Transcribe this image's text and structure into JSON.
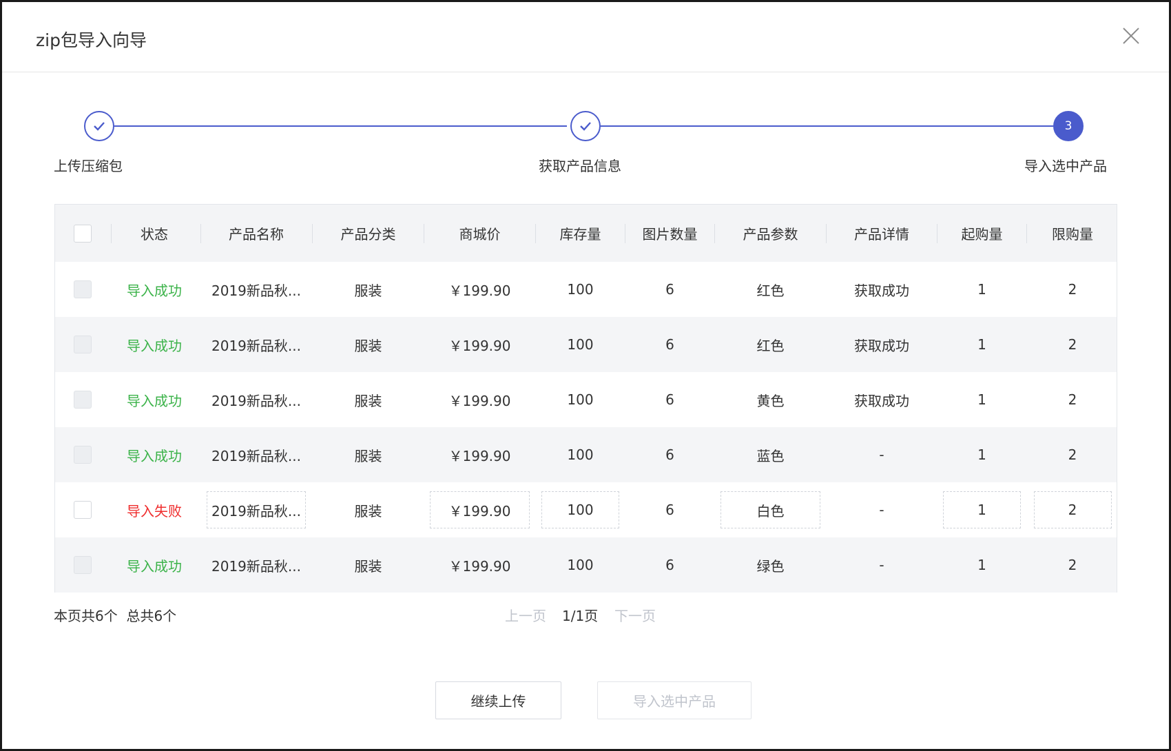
{
  "dialog": {
    "title": "zip包导入向导"
  },
  "steps": [
    {
      "label": "上传压缩包",
      "state": "done"
    },
    {
      "label": "获取产品信息",
      "state": "done"
    },
    {
      "label": "导入选中产品",
      "state": "active",
      "number": "3"
    }
  ],
  "colors": {
    "accent": "#4a5bcc",
    "success": "#3cb34a",
    "error": "#ef2d2d",
    "disabled_text": "#c0c4cc"
  },
  "table": {
    "headers": [
      "状态",
      "产品名称",
      "产品分类",
      "商城价",
      "库存量",
      "图片数量",
      "产品参数",
      "产品详情",
      "起购量",
      "限购量"
    ],
    "rows": [
      {
        "status": "导入成功",
        "status_type": "success",
        "name": "2019新品秋...",
        "category": "服装",
        "price": "￥199.90",
        "stock": "100",
        "images": "6",
        "params": "红色",
        "detail": "获取成功",
        "min_buy": "1",
        "max_buy": "2"
      },
      {
        "status": "导入成功",
        "status_type": "success",
        "name": "2019新品秋...",
        "category": "服装",
        "price": "￥199.90",
        "stock": "100",
        "images": "6",
        "params": "红色",
        "detail": "获取成功",
        "min_buy": "1",
        "max_buy": "2"
      },
      {
        "status": "导入成功",
        "status_type": "success",
        "name": "2019新品秋...",
        "category": "服装",
        "price": "￥199.90",
        "stock": "100",
        "images": "6",
        "params": "黄色",
        "detail": "获取成功",
        "min_buy": "1",
        "max_buy": "2"
      },
      {
        "status": "导入成功",
        "status_type": "success",
        "name": "2019新品秋...",
        "category": "服装",
        "price": "￥199.90",
        "stock": "100",
        "images": "6",
        "params": "蓝色",
        "detail": "-",
        "min_buy": "1",
        "max_buy": "2"
      },
      {
        "status": "导入失败",
        "status_type": "error",
        "name": "2019新品秋...",
        "category": "服装",
        "price": "￥199.90",
        "stock": "100",
        "images": "6",
        "params": "白色",
        "detail": "-",
        "min_buy": "1",
        "max_buy": "2"
      },
      {
        "status": "导入成功",
        "status_type": "success",
        "name": "2019新品秋...",
        "category": "服装",
        "price": "￥199.90",
        "stock": "100",
        "images": "6",
        "params": "绿色",
        "detail": "-",
        "min_buy": "1",
        "max_buy": "2"
      }
    ]
  },
  "footer": {
    "count_text": "本页共6个  总共6个",
    "prev_label": "上一页",
    "page_info": "1/1页",
    "next_label": "下一页"
  },
  "buttons": {
    "continue_label": "继续上传",
    "import_label": "导入选中产品"
  },
  "icons": {
    "close": "close-icon",
    "step_done": "check-icon"
  }
}
